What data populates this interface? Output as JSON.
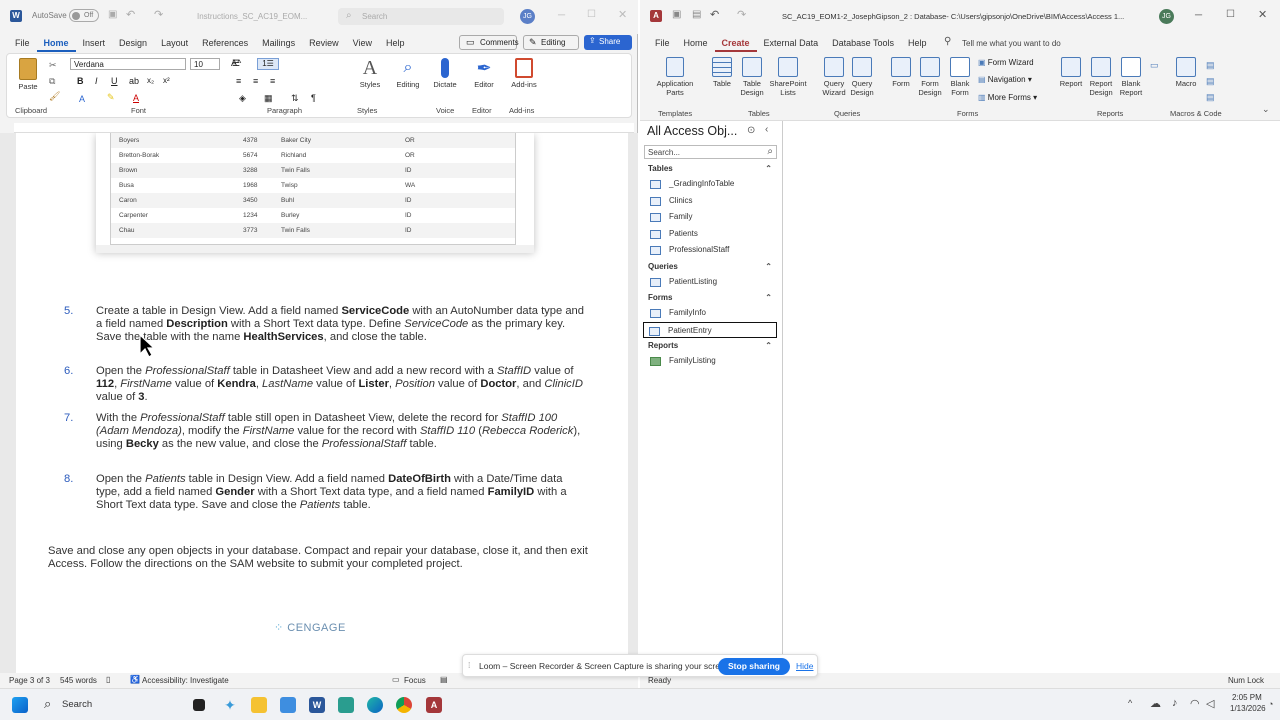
{
  "word": {
    "autosave": "AutoSave",
    "autosave_state": "Off",
    "filename": "Instructions_SC_AC19_EOM...",
    "search_placeholder": "Search",
    "user_initials": "JG",
    "tabs": [
      "File",
      "Home",
      "Insert",
      "Design",
      "Layout",
      "References",
      "Mailings",
      "Review",
      "View",
      "Help"
    ],
    "active_tab": "Home",
    "comments_btn": "Comments",
    "editing_btn": "Editing",
    "share_btn": "Share",
    "font_name": "Verdana",
    "font_size": "10",
    "ribbon": {
      "paste": "Paste",
      "clipboard": "Clipboard",
      "font": "Font",
      "paragraph": "Paragraph",
      "styles": "Styles",
      "styles_group": "Styles",
      "editing": "Editing",
      "dictate": "Dictate",
      "voice": "Voice",
      "editor": "Editor",
      "editor_group": "Editor",
      "addins": "Add-ins",
      "addins_group": "Add-ins"
    },
    "embedded_rows": [
      [
        "Boyers",
        "4378",
        "Baker City",
        "OR"
      ],
      [
        "Bretton-Borak",
        "5674",
        "Richland",
        "OR"
      ],
      [
        "Brown",
        "3288",
        "Twin Falls",
        "ID"
      ],
      [
        "Busa",
        "1968",
        "Twisp",
        "WA"
      ],
      [
        "Caron",
        "3450",
        "Buhl",
        "ID"
      ],
      [
        "Carpenter",
        "1234",
        "Burley",
        "ID"
      ],
      [
        "Chau",
        "3773",
        "Twin Falls",
        "ID"
      ]
    ],
    "steps": [
      {
        "num": "5.",
        "html": "Create a table in Design View. Add a field named <b>ServiceCode</b> with an AutoNumber data type and a field named <b>Description</b> with a Short Text data type. Define <i>ServiceCode</i> as the primary key. Save the table with the name <b>HealthServices</b>, and close the table."
      },
      {
        "num": "6.",
        "html": "Open the <i>ProfessionalStaff</i> table in Datasheet View and add a new record with a <i>StaffID</i> value of <b>112</b>, <i>FirstName</i> value of <b>Kendra</b>, <i>LastName</i> value of <b>Lister</b>, <i>Position</i> value of <b>Doctor</b>, and <i>ClinicID</i> value of <b>3</b>."
      },
      {
        "num": "7.",
        "html": "With the <i>ProfessionalStaff</i> table still open in Datasheet View, delete the record for <i>StaffID 100 (Adam Mendoza)</i>, modify the <i>FirstName</i> value for the record with <i>StaffID 110</i> (<i>Rebecca Roderick</i>), using <b>Becky</b> as the new value, and close the <i>ProfessionalStaff</i> table."
      },
      {
        "num": "8.",
        "html": "Open the <i>Patients</i> table in Design View. Add a field named <b>DateOfBirth</b> with a Date/Time data type, add a field named <b>Gender</b> with a Short Text data type, and a field named <b>FamilyID</b> with a Short Text data type. Save and close the <i>Patients</i> table."
      }
    ],
    "final_text": "Save and close any open objects in your database. Compact and repair your database, close it, and then exit Access. Follow the directions on the SAM website to submit your completed project.",
    "cengage": "CENGAGE",
    "status": {
      "page": "Page 3 of 3",
      "words": "545 words",
      "accessibility": "Accessibility: Investigate",
      "focus": "Focus"
    }
  },
  "access": {
    "title": "SC_AC19_EOM1-2_JosephGipson_2 : Database- C:\\Users\\gipsonjo\\OneDrive\\BIM\\Access\\Access 1...",
    "user_initials": "JG",
    "tabs": [
      "File",
      "Home",
      "Create",
      "External Data",
      "Database Tools",
      "Help"
    ],
    "active_tab": "Create",
    "tell_me": "Tell me what you want to do",
    "ribbon": {
      "app_parts": "Application Parts",
      "templates": "Templates",
      "table": "Table",
      "table_design": "Table Design",
      "sharepoint": "SharePoint Lists",
      "tables": "Tables",
      "query_wizard": "Query Wizard",
      "query_design": "Query Design",
      "queries": "Queries",
      "form": "Form",
      "form_design": "Form Design",
      "blank_form": "Blank Form",
      "form_wizard": "Form Wizard",
      "navigation": "Navigation",
      "more_forms": "More Forms",
      "forms": "Forms",
      "report": "Report",
      "report_design": "Report Design",
      "blank_report": "Blank Report",
      "reports": "Reports",
      "macro": "Macro",
      "macros_code": "Macros & Code"
    },
    "nav": {
      "header": "All Access Obj...",
      "search": "Search...",
      "sections": [
        {
          "name": "Tables",
          "items": [
            "_GradingInfoTable",
            "Clinics",
            "Family",
            "Patients",
            "ProfessionalStaff"
          ]
        },
        {
          "name": "Queries",
          "items": [
            "PatientListing"
          ]
        },
        {
          "name": "Forms",
          "items": [
            "FamilyInfo",
            "PatientEntry"
          ]
        },
        {
          "name": "Reports",
          "items": [
            "FamilyListing"
          ]
        }
      ]
    },
    "status_ready": "Ready",
    "num_lock": "Num Lock"
  },
  "loom": {
    "text": "Loom – Screen Recorder & Screen Capture is sharing your screen.",
    "stop": "Stop sharing",
    "hide": "Hide"
  },
  "taskbar": {
    "search": "Search",
    "time": "2:05 PM",
    "date": "1/13/2026"
  }
}
